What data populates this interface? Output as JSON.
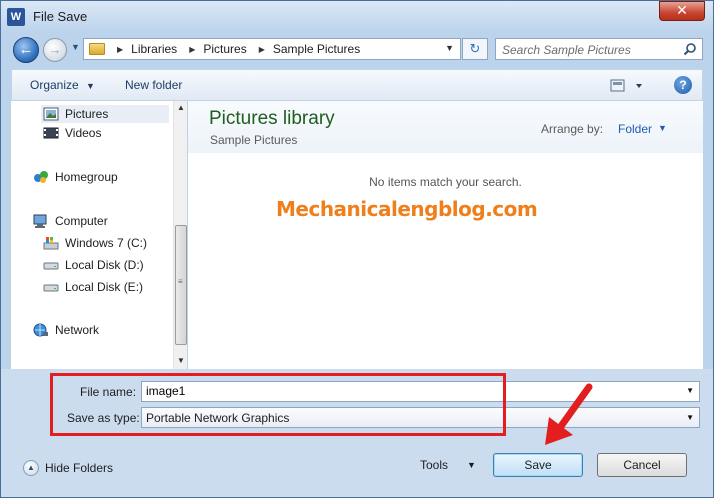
{
  "window": {
    "title": "File Save",
    "app_icon_letter": "W",
    "close_glyph": "✕"
  },
  "address_bar": {
    "crumbs": [
      "Libraries",
      "Pictures",
      "Sample Pictures"
    ],
    "refresh_glyph": "↻"
  },
  "search": {
    "placeholder": "Search Sample Pictures"
  },
  "toolbar": {
    "organize_label": "Organize",
    "new_folder_label": "New folder",
    "help_glyph": "?"
  },
  "nav": {
    "items": [
      {
        "label": "Pictures",
        "icon": "pictures-icon",
        "selected": true
      },
      {
        "label": "Videos",
        "icon": "videos-icon"
      },
      {
        "label": "Homegroup",
        "icon": "homegroup-icon"
      },
      {
        "label": "Computer",
        "icon": "computer-icon"
      },
      {
        "label": "Windows 7 (C:)",
        "icon": "system-drive-icon"
      },
      {
        "label": "Local Disk (D:)",
        "icon": "disk-drive-icon"
      },
      {
        "label": "Local Disk (E:)",
        "icon": "disk-drive-icon"
      },
      {
        "label": "Network",
        "icon": "network-icon"
      }
    ]
  },
  "library": {
    "title": "Pictures library",
    "subtitle": "Sample Pictures",
    "arrange_label": "Arrange by:",
    "arrange_value": "Folder",
    "empty_message": "No items match your search."
  },
  "watermark": "Mechanicalengblog.com",
  "fields": {
    "file_name_label": "File name:",
    "file_name_value": "image1",
    "save_type_label": "Save as type:",
    "save_type_value": "Portable Network Graphics"
  },
  "footer": {
    "hide_folders_label": "Hide Folders",
    "tools_label": "Tools",
    "save_label": "Save",
    "cancel_label": "Cancel"
  },
  "colors": {
    "highlight": "#e21e1e",
    "library_title": "#1e5e1e",
    "watermark": "#ef7f1a",
    "accent_link": "#1e5dad"
  }
}
